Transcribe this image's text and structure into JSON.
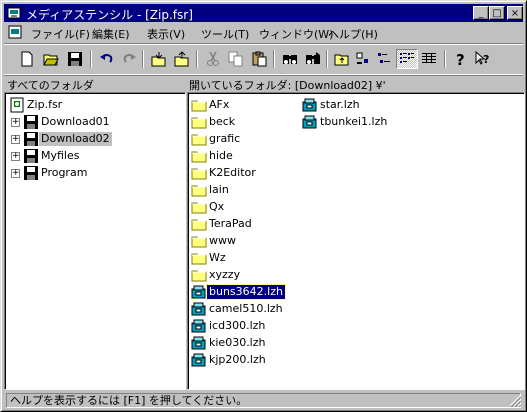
{
  "window": {
    "title": "メディアステンシル - [Zip.fsr]",
    "minimize_glyph": "_",
    "maximize_glyph": "□",
    "close_glyph": "×"
  },
  "menu": {
    "items": [
      "ファイル(F)",
      "編集(E)",
      "表示(V)",
      "ツール(T)",
      "ウィンドウ(W)",
      "ヘルプ(H)"
    ]
  },
  "toolbar": {
    "buttons": [
      "new-icon",
      "open-icon",
      "save-icon",
      "undo-icon",
      "redo-icon",
      "import-icon",
      "export-icon",
      "cut-icon",
      "copy-icon",
      "paste-icon",
      "find-icon",
      "find-next-icon",
      "up-folder-icon",
      "large-icons-icon",
      "small-icons-icon",
      "list-view-icon",
      "details-view-icon",
      "help-icon",
      "context-help-icon"
    ]
  },
  "left_pane": {
    "header": "すべてのフォルダ",
    "root": "Zip.fsr",
    "folders": [
      "Download01",
      "Download02",
      "Myfiles",
      "Program"
    ],
    "selected": "Download02"
  },
  "right_pane": {
    "header": "開いているフォルダ: [Download02] ¥'",
    "column1": [
      {
        "name": "AFx",
        "type": "folder"
      },
      {
        "name": "beck",
        "type": "folder"
      },
      {
        "name": "grafic",
        "type": "folder"
      },
      {
        "name": "hide",
        "type": "folder"
      },
      {
        "name": "K2Editor",
        "type": "folder"
      },
      {
        "name": "lain",
        "type": "folder"
      },
      {
        "name": "Qx",
        "type": "folder"
      },
      {
        "name": "TeraPad",
        "type": "folder"
      },
      {
        "name": "www",
        "type": "folder"
      },
      {
        "name": "Wz",
        "type": "folder"
      },
      {
        "name": "xyzzy",
        "type": "folder"
      },
      {
        "name": "buns3642.lzh",
        "type": "archive"
      },
      {
        "name": "camel510.lzh",
        "type": "archive"
      },
      {
        "name": "icd300.lzh",
        "type": "archive"
      },
      {
        "name": "kie030.lzh",
        "type": "archive"
      },
      {
        "name": "kjp200.lzh",
        "type": "archive"
      }
    ],
    "column2": [
      {
        "name": "star.lzh",
        "type": "archive"
      },
      {
        "name": "tbunkei1.lzh",
        "type": "archive"
      }
    ],
    "selected": "buns3642.lzh"
  },
  "statusbar": {
    "text": "ヘルプを表示するには [F1] を押してください。"
  },
  "colors": {
    "titlebar": "#000080",
    "face": "#c0c0c0",
    "folder": "#ffff80",
    "archive": "#00a0c0"
  }
}
